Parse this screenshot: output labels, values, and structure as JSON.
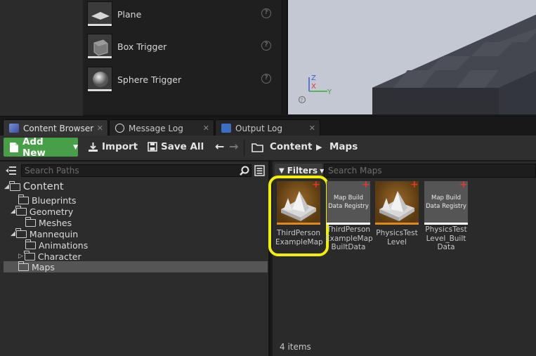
{
  "place_items": [
    {
      "label": "Plane",
      "icon": "plane-icon"
    },
    {
      "label": "Box Trigger",
      "icon": "box-trigger-icon"
    },
    {
      "label": "Sphere Trigger",
      "icon": "sphere-trigger-icon"
    }
  ],
  "viewport": {
    "axis_x": "X",
    "axis_y": "Y",
    "axis_z": "Z"
  },
  "tabs": [
    {
      "label": "Content Browser",
      "icon": "content-browser-icon",
      "active": true
    },
    {
      "label": "Message Log",
      "icon": "message-log-icon",
      "active": false
    },
    {
      "label": "Output Log",
      "icon": "output-log-icon",
      "active": false
    }
  ],
  "toolbar": {
    "add_new_label": "Add New",
    "import_label": "Import",
    "save_all_label": "Save All",
    "breadcrumb_root": "Content",
    "breadcrumb_current": "Maps"
  },
  "tree": {
    "search_placeholder": "Search Paths",
    "items": [
      {
        "label": "Content"
      },
      {
        "label": "Blueprints"
      },
      {
        "label": "Geometry"
      },
      {
        "label": "Meshes"
      },
      {
        "label": "Mannequin"
      },
      {
        "label": "Animations"
      },
      {
        "label": "Character"
      },
      {
        "label": "Maps"
      }
    ]
  },
  "assets": {
    "filters_label": "Filters",
    "search_placeholder": "Search Maps",
    "items": [
      {
        "line1": "ThirdPerson",
        "line2": "ExampleMap",
        "line3": "",
        "type": "level"
      },
      {
        "line1": "ThirdPerson",
        "line2": "ExampleMap",
        "line3": "BuiltData",
        "type": "registry",
        "thumb_line1": "Map Build",
        "thumb_line2": "Data Registry"
      },
      {
        "line1": "PhysicsTest",
        "line2": "Level",
        "line3": "",
        "type": "level"
      },
      {
        "line1": "PhysicsTest",
        "line2": "Level_Built",
        "line3": "Data",
        "type": "registry",
        "thumb_line1": "Map Build",
        "thumb_line2": "Data Registry"
      }
    ],
    "item_count": "4 items"
  },
  "colors": {
    "add_new_green": "#47a047",
    "highlight_yellow": "#f2f000",
    "level_bar": "#e08a1c",
    "registry_bar": "#ffffff",
    "new_asset_plus": "#e03b2a"
  }
}
